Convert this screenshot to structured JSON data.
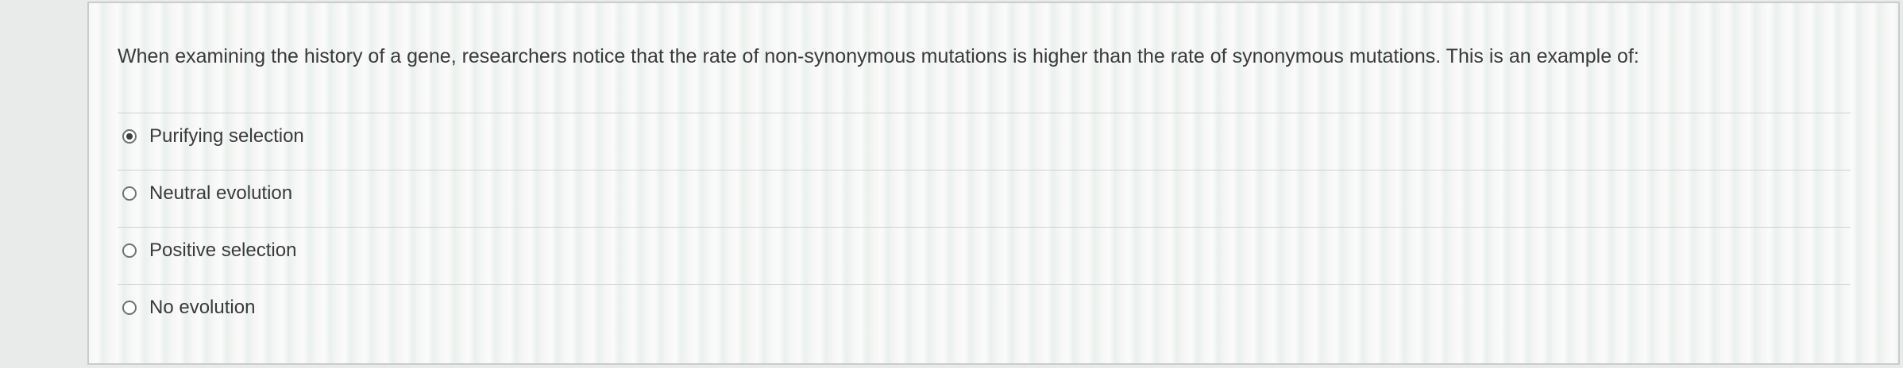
{
  "question": {
    "text": "When examining the history of a gene, researchers notice that the rate of non-synonymous mutations is higher than the rate of synonymous mutations. This is an example of:"
  },
  "options": [
    {
      "label": "Purifying selection",
      "selected": true
    },
    {
      "label": "Neutral evolution",
      "selected": false
    },
    {
      "label": "Positive selection",
      "selected": false
    },
    {
      "label": "No evolution",
      "selected": false
    }
  ],
  "colors": {
    "text": "#3a3a3a",
    "radio_border": "#6f7370",
    "radio_fill": "#3d3f3e",
    "divider": "#cfd2d0"
  }
}
